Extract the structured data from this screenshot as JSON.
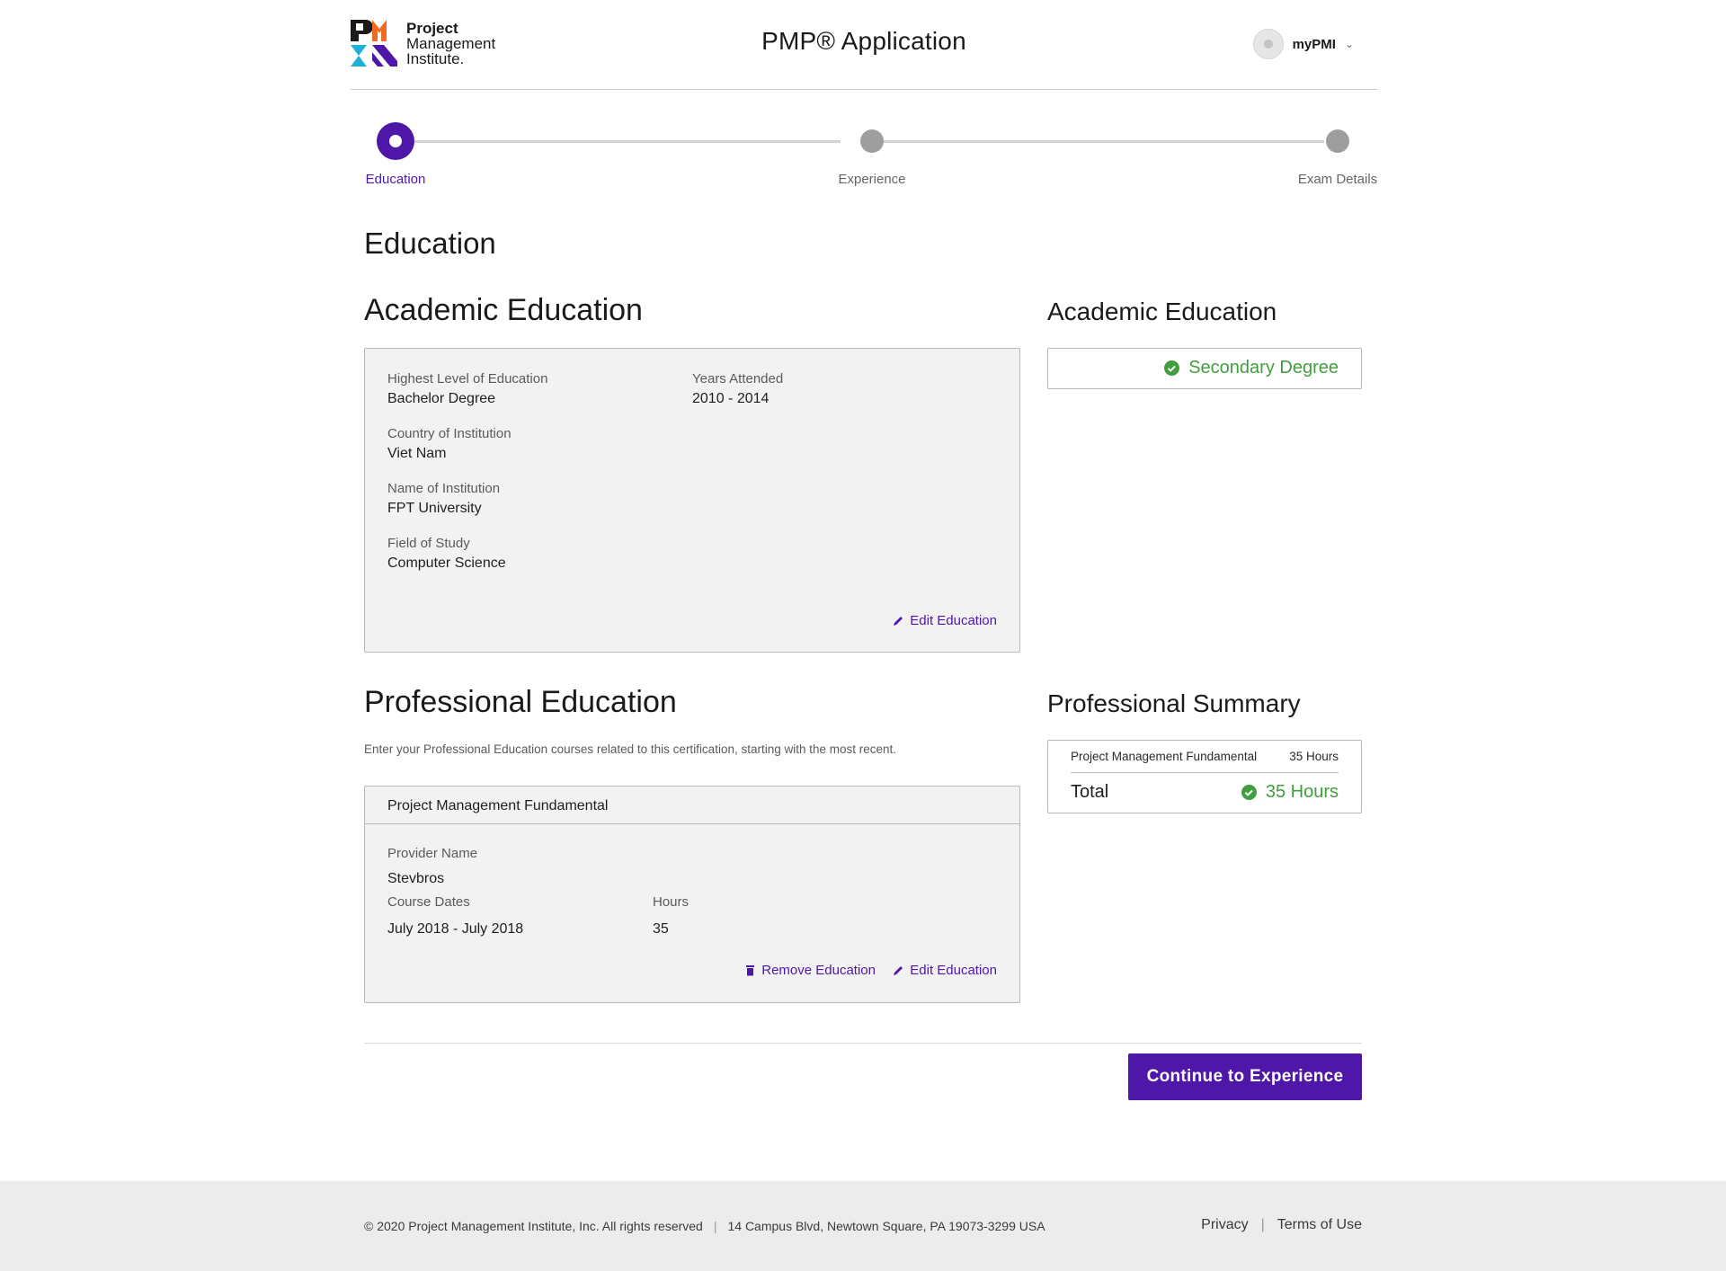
{
  "brand": {
    "line1": "Project",
    "line2": "Management",
    "line3": "Institute.",
    "purple": "#4f17a8",
    "green": "#3f9f3f"
  },
  "header": {
    "title": "PMP® Application",
    "user": "myPMI"
  },
  "stepper": {
    "steps": [
      {
        "label": "Education",
        "state": "active"
      },
      {
        "label": "Experience",
        "state": "pending"
      },
      {
        "label": "Exam Details",
        "state": "pending"
      }
    ]
  },
  "page_title": "Education",
  "academic": {
    "title": "Academic Education",
    "fields": {
      "level_label": "Highest Level of Education",
      "level_value": "Bachelor Degree",
      "years_label": "Years Attended",
      "years_value": "2010 - 2014",
      "country_label": "Country of Institution",
      "country_value": "Viet Nam",
      "institution_label": "Name of Institution",
      "institution_value": "FPT University",
      "field_label": "Field of Study",
      "field_value": "Computer Science"
    },
    "edit_label": "Edit Education"
  },
  "academic_side": {
    "title": "Academic Education",
    "status": "Secondary Degree"
  },
  "professional": {
    "title": "Professional Education",
    "instructions": "Enter your Professional Education courses related to this certification, starting with the most recent.",
    "course": {
      "name": "Project Management Fundamental",
      "provider_label": "Provider Name",
      "provider_value": "Stevbros",
      "dates_label": "Course Dates",
      "dates_value": "July 2018 - July 2018",
      "hours_label": "Hours",
      "hours_value": "35"
    },
    "remove_label": "Remove Education",
    "edit_label": "Edit Education"
  },
  "summary": {
    "title": "Professional Summary",
    "row_name": "Project Management Fundamental",
    "row_hours": "35 Hours",
    "total_label": "Total",
    "total_value": "35 Hours"
  },
  "actions": {
    "continue_label": "Continue to Experience"
  },
  "footer": {
    "copyright": "© 2020 Project Management Institute, Inc. All rights reserved",
    "separator": "|",
    "address": "14 Campus Blvd, Newtown Square, PA 19073-3299 USA",
    "privacy": "Privacy",
    "terms": "Terms of Use"
  }
}
